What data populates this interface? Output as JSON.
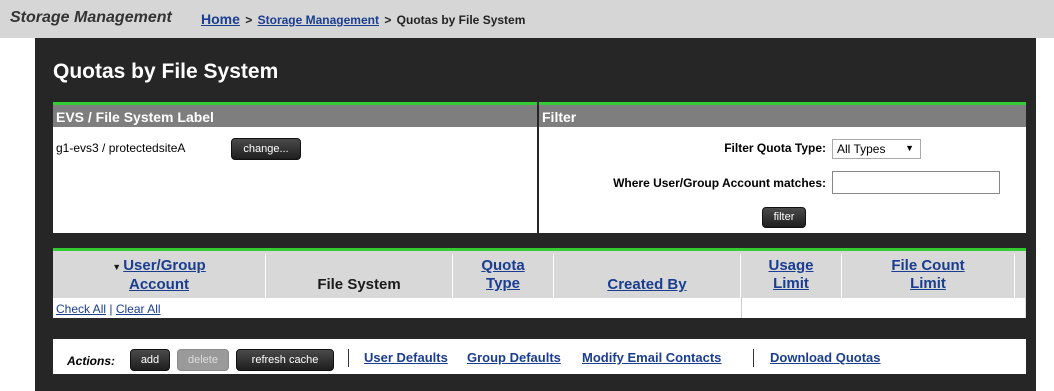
{
  "header": {
    "app_title": "Storage Management",
    "breadcrumb": {
      "home": "Home",
      "sep1": ">",
      "parent": "Storage Management",
      "sep2": ">",
      "current": "Quotas by File System"
    }
  },
  "page": {
    "title": "Quotas by File System"
  },
  "evs_box": {
    "heading": "EVS / File System Label",
    "value": "g1-evs3 /  protectedsiteA",
    "change_label": "change..."
  },
  "filter_box": {
    "heading": "Filter",
    "quota_type_label": "Filter Quota Type:",
    "quota_type_value": "All Types",
    "account_label": "Where User/Group Account matches:",
    "account_value": "",
    "filter_button": "filter"
  },
  "table": {
    "sort_indicator": "▼",
    "columns": {
      "account_line1": "User/Group",
      "account_line2": "Account",
      "file_system": "File System",
      "quota_line1": "Quota",
      "quota_line2": "Type",
      "created_by": "Created By",
      "usage_line1": "Usage",
      "usage_line2": "Limit",
      "filecount_line1": "File Count",
      "filecount_line2": "Limit"
    },
    "check_all": "Check All",
    "divider": "|",
    "clear_all": "Clear All"
  },
  "actions": {
    "label": "Actions:",
    "add": "add",
    "delete": "delete",
    "refresh_cache": "refresh cache",
    "user_defaults": "User Defaults",
    "group_defaults": "Group Defaults",
    "modify_email": "Modify Email Contacts",
    "download_quotas": "Download Quotas"
  },
  "colors": {
    "accent_green": "#33cc33",
    "panel_dark": "#262626",
    "header_gray": "#7e7e7e",
    "link_blue": "#1a3d8f"
  }
}
